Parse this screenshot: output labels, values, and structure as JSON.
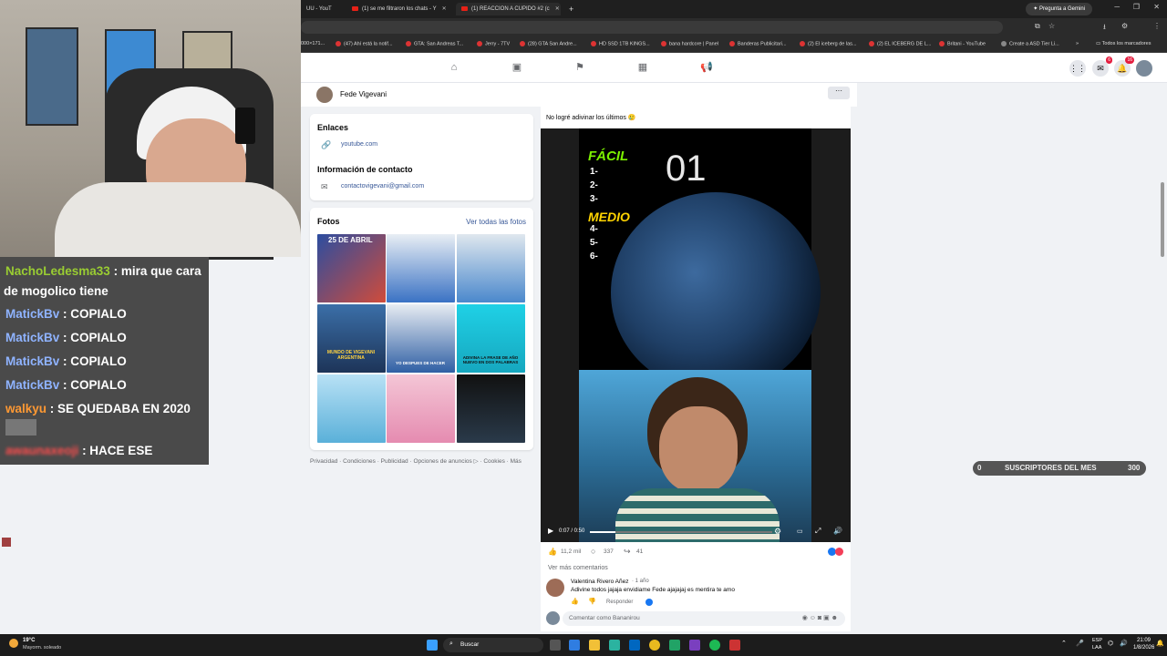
{
  "browser": {
    "tabs": [
      {
        "label": "UU - YouT"
      },
      {
        "label": "(1) se me filtraron los chats - Y"
      },
      {
        "label": "(1) REACCION A CUPIDO #2 (c"
      }
    ],
    "new_tab": "+",
    "gemini": "Pregunta a Gemini",
    "bookmarks": [
      "000×171...",
      "(47) Ahí está la notif...",
      "GTA: San Andreas T...",
      "Jerry - 7TV",
      "(28) GTA San Andre...",
      "HD SSD 1TB KINGS...",
      "bana hardcore | Panel",
      "Banderas Publicitari...",
      "(2) El iceberg de las...",
      "(2) EL ICEBERG DE L...",
      "Britani - YouTube",
      "Create a ASD Tier Li..."
    ],
    "all_bookmarks": "Todos los marcadores"
  },
  "fbnav": {
    "messenger_badge": "6",
    "notif_badge": "16"
  },
  "profile": {
    "name": "Fede Vigevani"
  },
  "links_card": {
    "title": "Enlaces",
    "link": "youtube.com",
    "contact_title": "Información de contacto",
    "email": "contactovigevani@gmail.com"
  },
  "photos_card": {
    "title": "Fotos",
    "see_all": "Ver todas las fotos",
    "captions": [
      "25 DE ABRIL",
      "",
      "",
      "MUNDO DE VIGEVANI ARGENTINA",
      "YO DESPUES DE HACER",
      "ADIVINA LA FRASE DE AÑO NUEVO EN DOS PALABRAS",
      "",
      "",
      ""
    ]
  },
  "footer_links": "Privacidad · Condiciones · Publicidad · Opciones de anuncios ▷ · Cookies · Más",
  "post": {
    "caption": "No logré adivinar los últimos 🥲",
    "video_overlay": {
      "facil": "FÁCIL",
      "medio": "MEDIO",
      "nums": [
        "1-",
        "2-",
        "3-",
        "4-",
        "5-",
        "6-"
      ],
      "counter": "01"
    },
    "time": "0:07 / 0:50",
    "likes": "11,2 mil",
    "comments": "337",
    "shares": "41",
    "more_comments": "Ver más comentarios",
    "comment_author": "Valentina Rivero Añez",
    "comment_time": "· 1 año",
    "comment_text": "Adivine todos jajaja envidiame Fede ajajajaj es mentira te amo",
    "reply": "Responder",
    "comment_placeholder": "Comentar como Bananirou"
  },
  "sub_widget": {
    "left": "0",
    "label": "SUSCRIPTORES DEL MES",
    "right": "300"
  },
  "chat": [
    {
      "user": "NachoLedesma33",
      "color": "#9acd32",
      "text": ": mira que cara",
      "cont": "de mogolico tiene"
    },
    {
      "user": "MatickBv",
      "color": "#8fb3ff",
      "text": ": COPIALO"
    },
    {
      "user": "MatickBv",
      "color": "#8fb3ff",
      "text": ": COPIALO"
    },
    {
      "user": "MatickBv",
      "color": "#8fb3ff",
      "text": ": COPIALO"
    },
    {
      "user": "MatickBv",
      "color": "#8fb3ff",
      "text": ": COPIALO"
    },
    {
      "user": "walkyu",
      "color": "#ff9933",
      "text": ": SE QUEDABA EN 2020"
    },
    {
      "user": "awaunaxeoji",
      "color": "#ff4d4d",
      "text": ": HACE ESE"
    }
  ],
  "taskbar": {
    "weather_temp": "19°C",
    "weather_desc": "Mayorm. soleado",
    "search": "Buscar",
    "lang": "ESP",
    "lang2": "LAA",
    "time": "21:09",
    "date": "1/8/2026"
  }
}
